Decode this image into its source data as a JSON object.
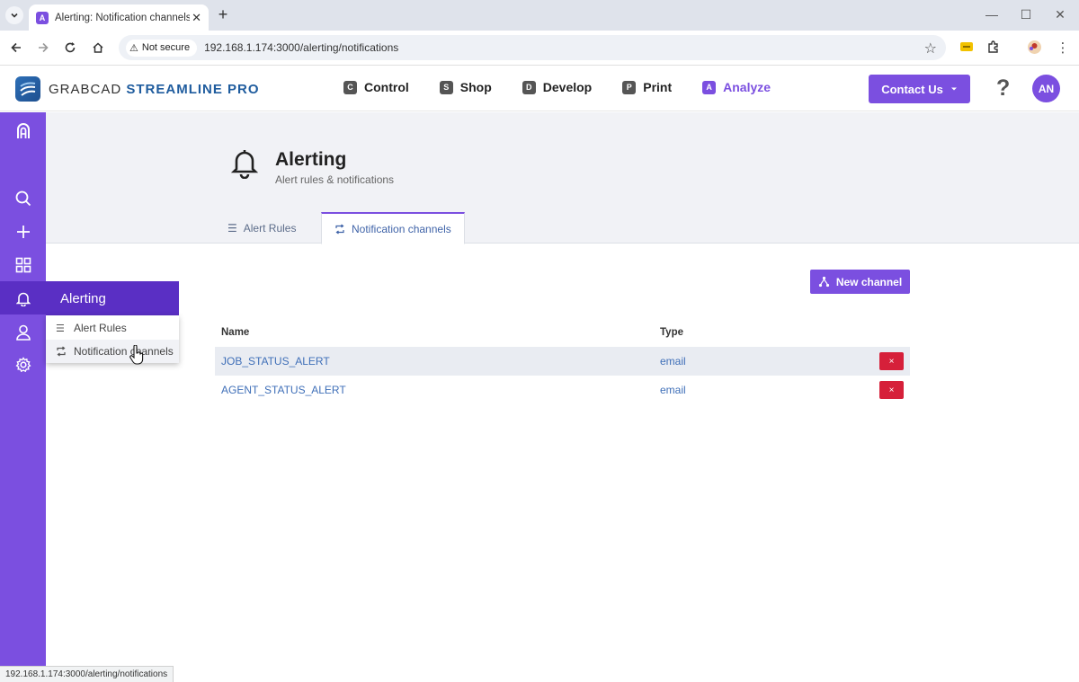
{
  "browser": {
    "tab_title": "Alerting: Notification channels -",
    "tab_favicon": "A",
    "url": "192.168.1.174:3000/alerting/notifications",
    "security_label": "Not secure",
    "status_url": "192.168.1.174:3000/alerting/notifications"
  },
  "header": {
    "brand_prefix": "GRABCAD",
    "brand_name": "STREAMLINE PRO",
    "nav": [
      {
        "label": "Control",
        "glyph": "C",
        "active": false
      },
      {
        "label": "Shop",
        "glyph": "S",
        "active": false
      },
      {
        "label": "Develop",
        "glyph": "D",
        "active": false
      },
      {
        "label": "Print",
        "glyph": "P",
        "active": false
      },
      {
        "label": "Analyze",
        "glyph": "A",
        "active": true
      }
    ],
    "contact_label": "Contact Us",
    "help_label": "?",
    "avatar_initials": "AN"
  },
  "page": {
    "title": "Alerting",
    "subtitle": "Alert rules & notifications",
    "tabs": [
      {
        "label": "Alert Rules",
        "active": false
      },
      {
        "label": "Notification channels",
        "active": true
      }
    ],
    "new_channel_label": "New channel"
  },
  "table": {
    "headers": [
      "Name",
      "Type"
    ],
    "rows": [
      {
        "name": "JOB_STATUS_ALERT",
        "type": "email"
      },
      {
        "name": "AGENT_STATUS_ALERT",
        "type": "email"
      }
    ],
    "delete_glyph": "×"
  },
  "flyout": {
    "title": "Alerting",
    "items": [
      {
        "label": "Alert Rules"
      },
      {
        "label": "Notification channels"
      }
    ]
  },
  "colors": {
    "accent": "#7b4fe0",
    "accent_dark": "#5a2fc4",
    "link": "#3f6fb8",
    "danger": "#d6203a"
  }
}
